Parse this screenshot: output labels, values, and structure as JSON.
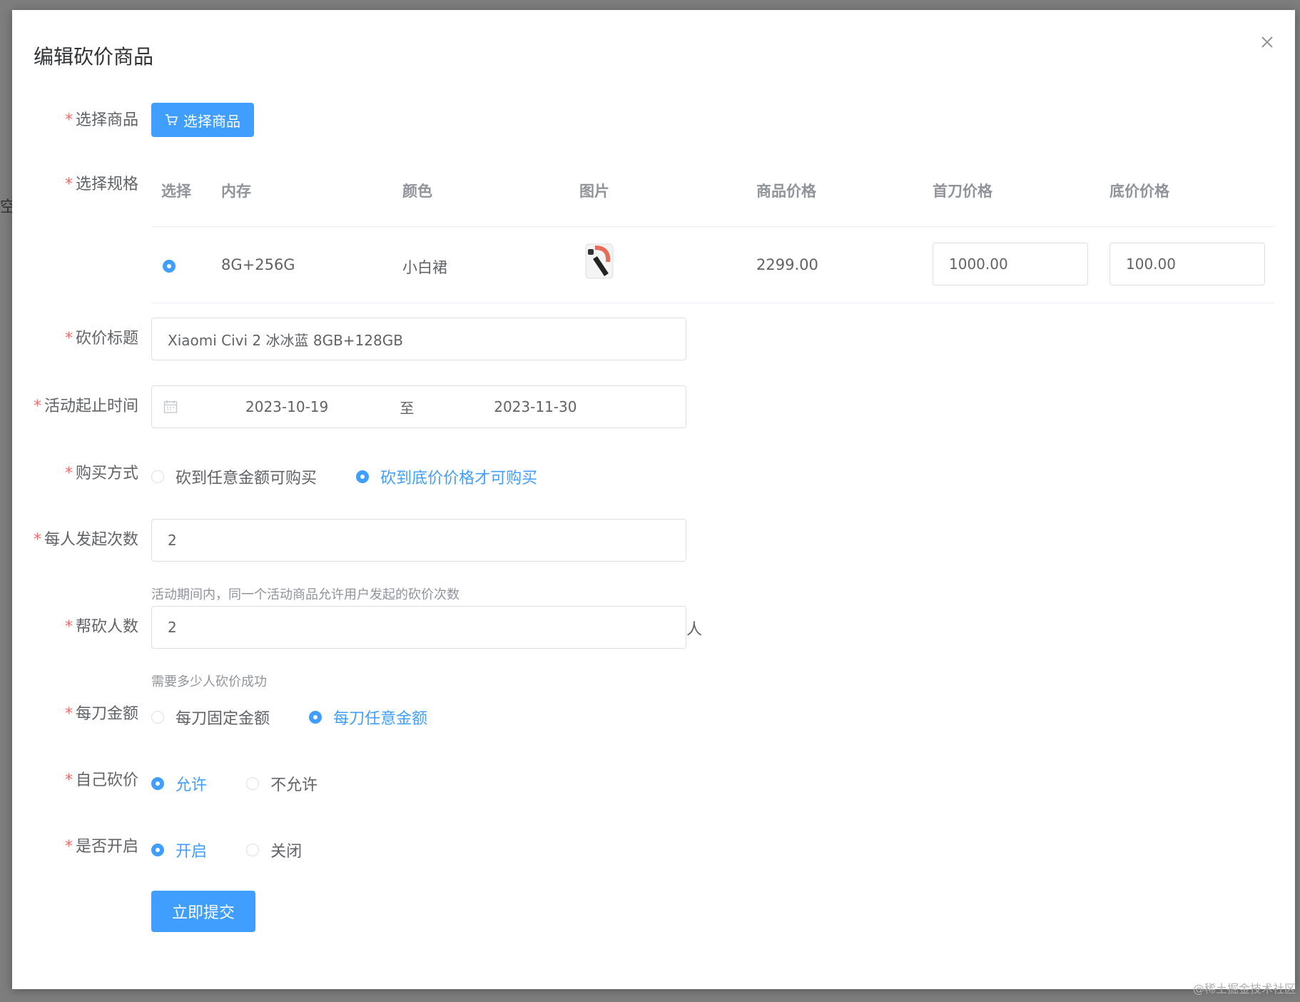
{
  "background": {
    "fragment": "空"
  },
  "dialog": {
    "title": "编辑砍价商品"
  },
  "form": {
    "goods": {
      "label": "选择商品",
      "button": "选择商品"
    },
    "spec": {
      "label": "选择规格",
      "columns": [
        "选择",
        "内存",
        "颜色",
        "图片",
        "商品价格",
        "首刀价格",
        "底价价格"
      ],
      "row": {
        "selected": true,
        "memory": "8G+256G",
        "color": "小白裙",
        "price": "2299.00",
        "first_cut": "1000.00",
        "floor_price": "100.00"
      }
    },
    "title": {
      "label": "砍价标题",
      "value": "Xiaomi Civi 2 冰冰蓝 8GB+128GB"
    },
    "period": {
      "label": "活动起止时间",
      "start": "2023-10-19",
      "separator": "至",
      "end": "2023-11-30"
    },
    "buy_mode": {
      "label": "购买方式",
      "options": [
        "砍到任意金额可购买",
        "砍到底价价格才可购买"
      ],
      "selected": 1
    },
    "launch_count": {
      "label": "每人发起次数",
      "value": "2",
      "hint": "活动期间内，同一个活动商品允许用户发起的砍价次数"
    },
    "helpers": {
      "label": "帮砍人数",
      "value": "2",
      "unit": "人",
      "hint": "需要多少人砍价成功"
    },
    "cut_amount": {
      "label": "每刀金额",
      "options": [
        "每刀固定金额",
        "每刀任意金额"
      ],
      "selected": 1
    },
    "self_cut": {
      "label": "自己砍价",
      "options": [
        "允许",
        "不允许"
      ],
      "selected": 0
    },
    "enabled": {
      "label": "是否开启",
      "options": [
        "开启",
        "关闭"
      ],
      "selected": 0
    },
    "submit": "立即提交"
  },
  "watermark": "@稀土掘金技术社区",
  "colors": {
    "primary": "#409eff",
    "required": "#f56c6c",
    "border": "#dcdfe6"
  }
}
